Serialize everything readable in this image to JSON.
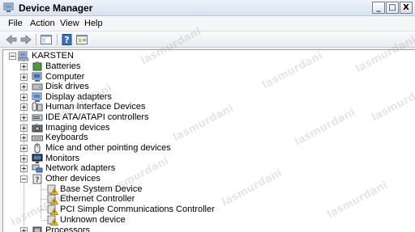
{
  "window": {
    "title": "Device Manager"
  },
  "caption_buttons": {
    "minimize": "_",
    "maximize": "□",
    "close": "X"
  },
  "menu": [
    "File",
    "Action",
    "View",
    "Help"
  ],
  "tree": {
    "root": "KARSTEN",
    "categories": [
      {
        "label": "Batteries",
        "icon": "battery-icon",
        "expanded": false
      },
      {
        "label": "Computer",
        "icon": "computer-icon",
        "expanded": false
      },
      {
        "label": "Disk drives",
        "icon": "disk-drive-icon",
        "expanded": false
      },
      {
        "label": "Display adapters",
        "icon": "display-adapter-icon",
        "expanded": false
      },
      {
        "label": "Human Interface Devices",
        "icon": "hid-icon",
        "expanded": false
      },
      {
        "label": "IDE ATA/ATAPI controllers",
        "icon": "ide-controller-icon",
        "expanded": false
      },
      {
        "label": "Imaging devices",
        "icon": "camera-icon",
        "expanded": false
      },
      {
        "label": "Keyboards",
        "icon": "keyboard-icon",
        "expanded": false
      },
      {
        "label": "Mice and other pointing devices",
        "icon": "mouse-icon",
        "expanded": false
      },
      {
        "label": "Monitors",
        "icon": "monitor-icon",
        "expanded": false
      },
      {
        "label": "Network adapters",
        "icon": "network-adapter-icon",
        "expanded": false
      },
      {
        "label": "Other devices",
        "icon": "unknown-device-icon",
        "expanded": true
      },
      {
        "label": "Processors",
        "icon": "processor-icon",
        "expanded": false
      }
    ],
    "other_devices": [
      {
        "label": "Base System Device",
        "icon": "warning-device-icon"
      },
      {
        "label": "Ethernet Controller",
        "icon": "warning-device-icon"
      },
      {
        "label": "PCI Simple Communications Controller",
        "icon": "warning-device-icon"
      },
      {
        "label": "Unknown device",
        "icon": "warning-device-icon"
      }
    ]
  },
  "watermark": "lasmurdani",
  "colors": {
    "title_bar": "#dbe6f4",
    "warning": "#f2c21b",
    "tree_bg": "#ffffff"
  }
}
